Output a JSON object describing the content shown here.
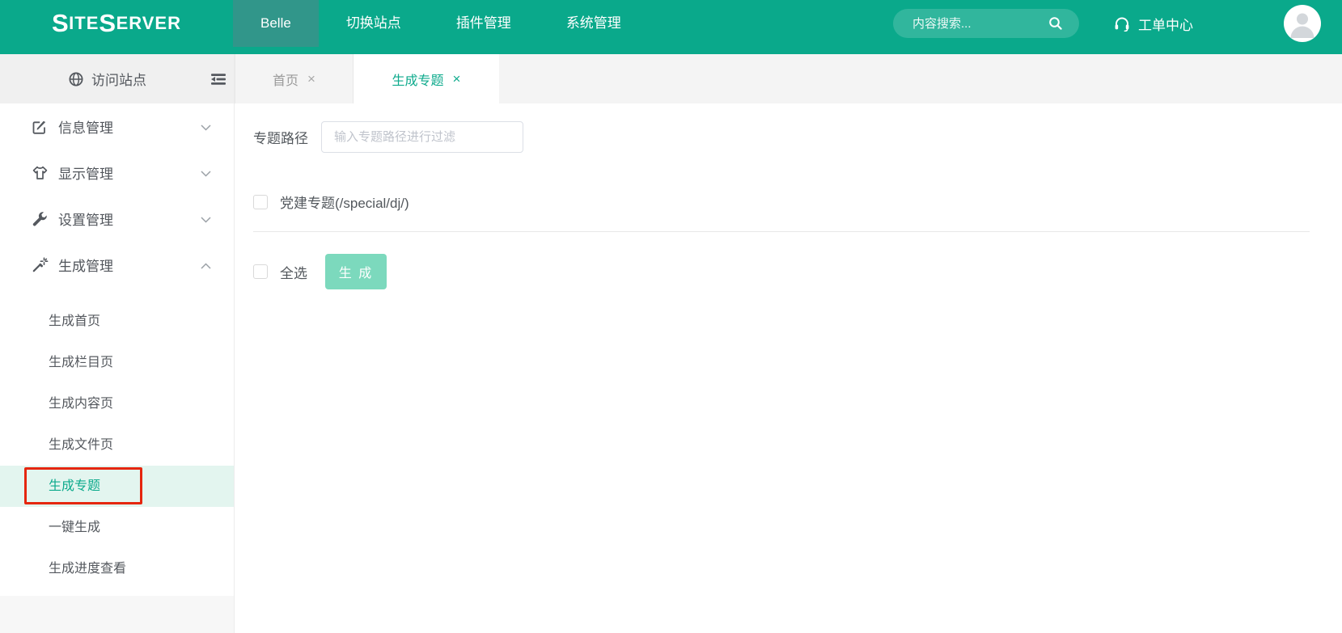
{
  "header": {
    "logo": {
      "s1": "S",
      "m1": "ITE",
      "s2": "S",
      "m2": "ERVER"
    },
    "nav_items": [
      {
        "label": "Belle",
        "active": true
      },
      {
        "label": "切换站点",
        "active": false
      },
      {
        "label": "插件管理",
        "active": false
      },
      {
        "label": "系统管理",
        "active": false
      }
    ],
    "search": {
      "placeholder": "内容搜索..."
    },
    "ticket_center_label": "工单中心"
  },
  "sidebar": {
    "visit_site_label": "访问站点",
    "menu_items": [
      {
        "label": "信息管理",
        "icon": "edit-icon",
        "state": "collapsed"
      },
      {
        "label": "显示管理",
        "icon": "tshirt-icon",
        "state": "collapsed"
      },
      {
        "label": "设置管理",
        "icon": "wrench-icon",
        "state": "collapsed"
      },
      {
        "label": "生成管理",
        "icon": "magic-wand-icon",
        "state": "expanded"
      }
    ],
    "submenu_items": [
      {
        "label": "生成首页",
        "active": false
      },
      {
        "label": "生成栏目页",
        "active": false
      },
      {
        "label": "生成内容页",
        "active": false
      },
      {
        "label": "生成文件页",
        "active": false
      },
      {
        "label": "生成专题",
        "active": true,
        "highlight_annotation": true
      },
      {
        "label": "一键生成",
        "active": false
      },
      {
        "label": "生成进度查看",
        "active": false
      }
    ]
  },
  "tabs": [
    {
      "label": "首页",
      "close_glyph": "×",
      "active": false
    },
    {
      "label": "生成专题",
      "close_glyph": "×",
      "active": true
    }
  ],
  "content": {
    "filter": {
      "label": "专题路径",
      "placeholder": "输入专题路径进行过滤"
    },
    "topic_items": [
      {
        "label": "党建专题(/special/dj/)",
        "checked": false
      }
    ],
    "select_all_label": "全选",
    "generate_button_label": "生 成"
  },
  "colors": {
    "header_teal": "#0aa98b",
    "active_nav_teal": "#31968a",
    "accent_teal": "#0daa8c",
    "active_row_bg": "#e3f5ef",
    "annotation_red": "#e5260f",
    "generate_button_mint": "#7cd9bd"
  }
}
